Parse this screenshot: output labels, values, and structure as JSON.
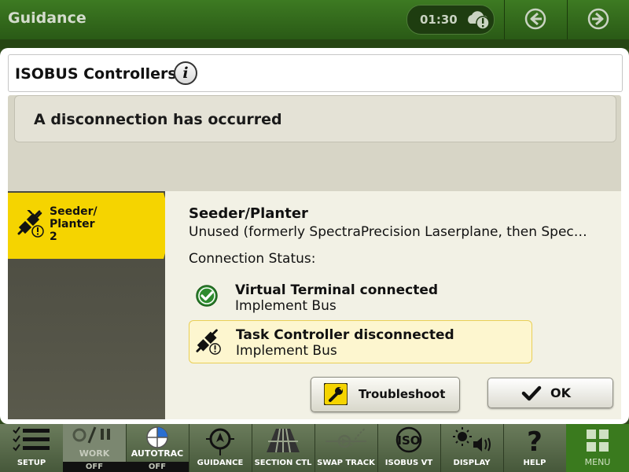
{
  "topbar": {
    "title": "Guidance",
    "clock": "01:30"
  },
  "dialog": {
    "title": "ISOBUS Controllers",
    "alert": "A disconnection has occurred",
    "device_tab": {
      "label": "Seeder/\nPlanter\n2"
    },
    "detail": {
      "title": "Seeder/Planter",
      "description": "Unused (formerly SpectraPrecision Laserplane, then Spec…",
      "connection_label": "Connection Status:",
      "statuses": [
        {
          "name": "Virtual Terminal connected",
          "bus": "Implement Bus",
          "state": "connected",
          "color": "#2e8b2e"
        },
        {
          "name": "Task Controller disconnected",
          "bus": "Implement Bus",
          "state": "disconnected",
          "color": "#e9cf55"
        }
      ],
      "troubleshoot_label": "Troubleshoot"
    },
    "ok_label": "OK"
  },
  "bottombar": {
    "items": [
      {
        "label": "SETUP"
      },
      {
        "label": "WORK",
        "status": "OFF"
      },
      {
        "label": "AUTOTRAC",
        "status": "OFF"
      },
      {
        "label": "GUIDANCE"
      },
      {
        "label": "SECTION CTL"
      },
      {
        "label": "SWAP TRACK"
      },
      {
        "label": "ISOBUS VT"
      },
      {
        "label": "DISPLAY"
      },
      {
        "label": "HELP"
      },
      {
        "label": "MENU"
      }
    ]
  },
  "colors": {
    "accent_yellow": "#f5d400",
    "topbar_green": "#3d7a22",
    "menu_green": "#3a7a1e"
  }
}
